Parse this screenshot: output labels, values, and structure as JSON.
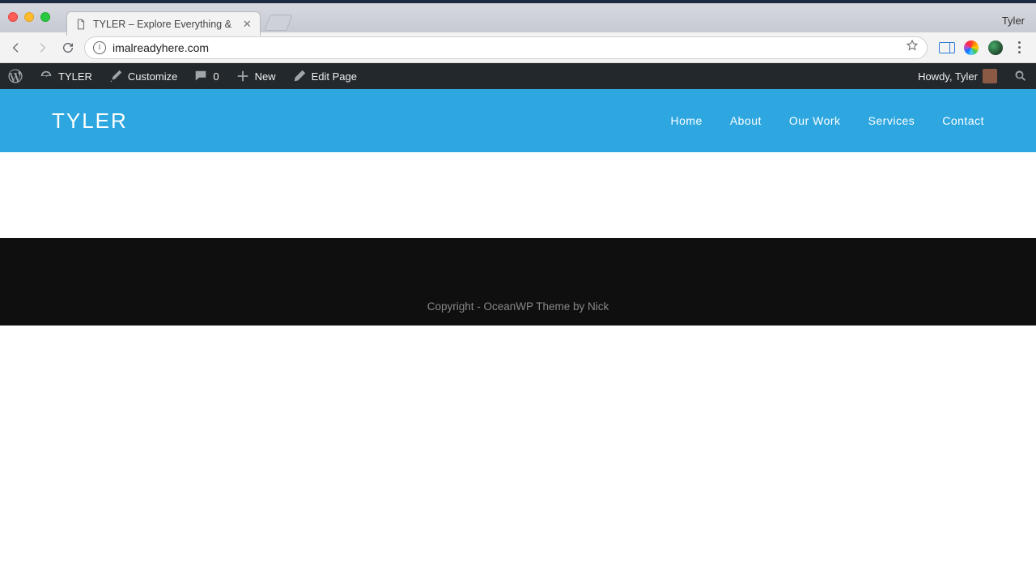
{
  "browser": {
    "user_label": "Tyler",
    "tab_title": "TYLER – Explore Everything &",
    "url": "imalreadyhere.com"
  },
  "wp_adminbar": {
    "site_name": "TYLER",
    "customize": "Customize",
    "comments_count": "0",
    "new": "New",
    "edit_page": "Edit Page",
    "howdy": "Howdy, Tyler"
  },
  "site": {
    "logo": "TYLER",
    "nav": {
      "home": "Home",
      "about": "About",
      "our_work": "Our Work",
      "services": "Services",
      "contact": "Contact"
    },
    "footer_copyright": "Copyright - OceanWP Theme by Nick"
  },
  "colors": {
    "header_bg": "#2ea7e0",
    "adminbar_bg": "#23282d",
    "footer_bg": "#0f0f0f"
  }
}
